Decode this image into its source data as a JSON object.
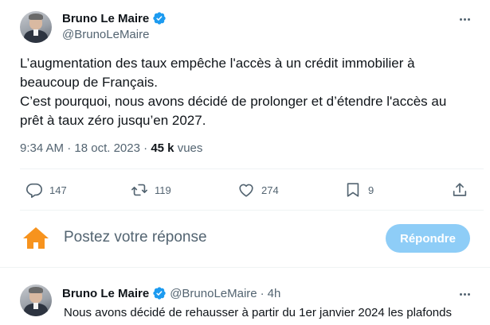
{
  "main_tweet": {
    "display_name": "Bruno Le Maire",
    "handle": "@BrunoLeMaire",
    "lines": [
      "L’augmentation des taux empêche l'accès à un crédit immobilier à",
      "beaucoup de Français.",
      "C’est pourquoi, nous avons décidé de prolonger et d’étendre l'accès au",
      "prêt à taux zéro jusqu’en 2027."
    ],
    "time": "9:34 AM",
    "sep": "·",
    "date": "18 oct. 2023",
    "views_count": "45 k",
    "views_label": "vues"
  },
  "actions": {
    "replies": "147",
    "reposts": "119",
    "likes": "274",
    "bookmarks": "9"
  },
  "reply_box": {
    "placeholder": "Postez votre réponse",
    "button_label": "Répondre"
  },
  "next_tweet": {
    "display_name": "Bruno Le Maire",
    "handle": "@BrunoLeMaire",
    "sep": "·",
    "age": "4h",
    "line1": "Nous avons décidé de rehausser à partir du 1er janvier 2024 les plafonds"
  },
  "colors": {
    "verified": "#1d9bf0",
    "muted": "#536471",
    "reply_button": "#8ecdf7",
    "reply_avatar": "#f7931e"
  }
}
